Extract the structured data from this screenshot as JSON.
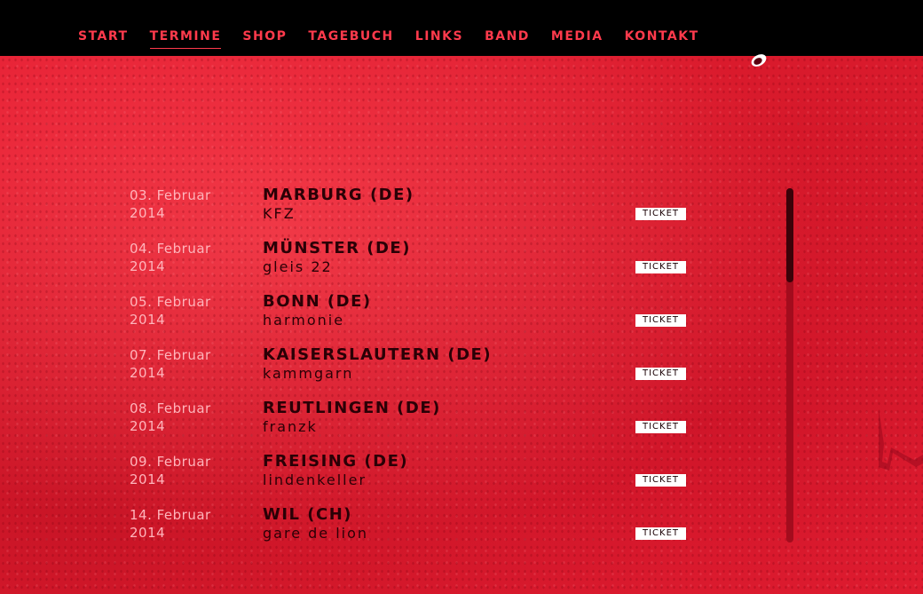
{
  "nav": {
    "items": [
      {
        "label": "START",
        "active": false
      },
      {
        "label": "TERMINE",
        "active": true
      },
      {
        "label": "SHOP",
        "active": false
      },
      {
        "label": "TAGEBUCH",
        "active": false
      },
      {
        "label": "LINKS",
        "active": false
      },
      {
        "label": "BAND",
        "active": false
      },
      {
        "label": "MEDIA",
        "active": false
      },
      {
        "label": "KONTAKT",
        "active": false
      }
    ]
  },
  "events": [
    {
      "date": "03. Februar",
      "year": "2014",
      "city": "MARBURG (DE)",
      "venue": "KFZ",
      "ticket": "TICKET"
    },
    {
      "date": "04. Februar",
      "year": "2014",
      "city": "MÜNSTER (DE)",
      "venue": "gleis 22",
      "ticket": "TICKET"
    },
    {
      "date": "05. Februar",
      "year": "2014",
      "city": "BONN (DE)",
      "venue": "harmonie",
      "ticket": "TICKET"
    },
    {
      "date": "07. Februar",
      "year": "2014",
      "city": "KAISERSLAUTERN (DE)",
      "venue": "kammgarn",
      "ticket": "TICKET"
    },
    {
      "date": "08. Februar",
      "year": "2014",
      "city": "REUTLINGEN (DE)",
      "venue": "franzk",
      "ticket": "TICKET"
    },
    {
      "date": "09. Februar",
      "year": "2014",
      "city": "FREISING (DE)",
      "venue": "lindenkeller",
      "ticket": "TICKET"
    },
    {
      "date": "14. Februar",
      "year": "2014",
      "city": "WIL (CH)",
      "venue": "gare de lion",
      "ticket": "TICKET"
    }
  ],
  "colors": {
    "background": "#e51e32",
    "nav_text": "#ff3a4c",
    "topbar": "#000000"
  }
}
